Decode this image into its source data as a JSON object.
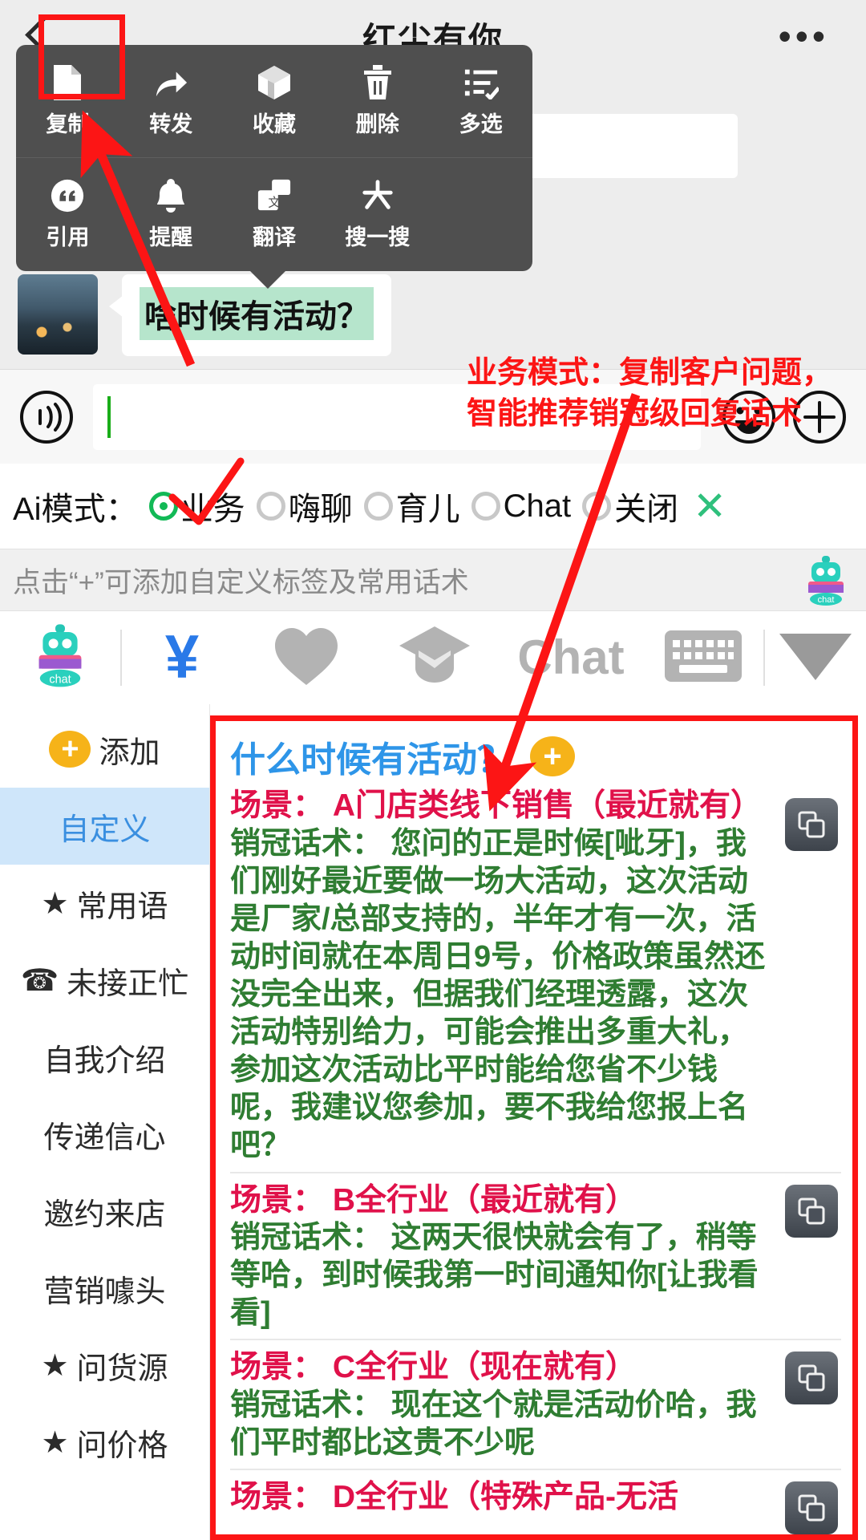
{
  "header": {
    "title": "红尘有你",
    "back_icon": "back-chevron-icon",
    "more_icon": "more-dots-icon"
  },
  "context_menu": {
    "row1": [
      {
        "label": "复制",
        "icon": "copy-document-icon",
        "highlighted": true
      },
      {
        "label": "转发",
        "icon": "forward-arrow-icon"
      },
      {
        "label": "收藏",
        "icon": "favorite-box-icon"
      },
      {
        "label": "删除",
        "icon": "trash-icon"
      },
      {
        "label": "多选",
        "icon": "multi-select-icon"
      }
    ],
    "row2": [
      {
        "label": "引用",
        "icon": "quote-icon"
      },
      {
        "label": "提醒",
        "icon": "bell-icon"
      },
      {
        "label": "翻译",
        "icon": "translate-icon"
      },
      {
        "label": "搜一搜",
        "icon": "search-sparkle-icon"
      }
    ]
  },
  "chat": {
    "avatar": "user-avatar",
    "message_text": "啥时候有活动？"
  },
  "input_bar": {
    "voice_icon": "voice-wave-icon",
    "input_value": "",
    "emoji_icon": "smiley-icon",
    "plus_icon": "plus-circle-icon"
  },
  "ai_mode": {
    "label": "Ai模式：",
    "options": [
      {
        "label": "业务",
        "selected": true
      },
      {
        "label": "嗨聊",
        "selected": false
      },
      {
        "label": "育儿",
        "selected": false
      },
      {
        "label": "Chat",
        "selected": false
      },
      {
        "label": "关闭",
        "selected": false
      }
    ],
    "close_icon": "close-x-icon",
    "accent_color": "#12b956"
  },
  "hint": {
    "text": "点击“+”可添加自定义标签及常用话术",
    "bot_icon": "robot-chat-icon"
  },
  "icon_toolbar": [
    {
      "name": "robot-chat-icon",
      "label": "chat"
    },
    {
      "name": "yuan-currency-icon",
      "label": "¥"
    },
    {
      "name": "heart-icon",
      "label": ""
    },
    {
      "name": "graduation-cap-icon",
      "label": ""
    },
    {
      "name": "chat-text-icon",
      "label": "Chat"
    },
    {
      "name": "keyboard-icon",
      "label": ""
    },
    {
      "name": "chevron-down-triangle-icon",
      "label": ""
    }
  ],
  "sidebar": {
    "items": [
      {
        "label": "添加",
        "icon": "plus-badge-icon",
        "active": false
      },
      {
        "label": "自定义",
        "icon": "",
        "active": true
      },
      {
        "label": "常用语",
        "icon": "star-icon",
        "active": false
      },
      {
        "label": "未接正忙",
        "icon": "telephone-icon",
        "active": false
      },
      {
        "label": "自我介绍",
        "icon": "",
        "active": false
      },
      {
        "label": "传递信心",
        "icon": "",
        "active": false
      },
      {
        "label": "邀约来店",
        "icon": "",
        "active": false
      },
      {
        "label": "营销噱头",
        "icon": "",
        "active": false
      },
      {
        "label": "问货源",
        "icon": "star-icon",
        "active": false
      },
      {
        "label": "问价格",
        "icon": "star-icon",
        "active": false
      }
    ]
  },
  "content": {
    "question_title": "什么时候有活动？",
    "add_icon": "plus-badge-icon",
    "scene_label": "场景：",
    "script_label": "销冠话术：",
    "copy_icon": "copy-duplicate-icon",
    "scenes": [
      {
        "head": "场景： A门店类线下销售（最近就有）",
        "body": "销冠话术： 您问的正是时候[呲牙]，我们刚好最近要做一场大活动，这次活动是厂家/总部支持的，半年才有一次，活动时间就在本周日9号，价格政策虽然还没完全出来，但据我们经理透露，这次活动特别给力，可能会推出多重大礼，参加这次活动比平时能给您省不少钱呢，我建议您参加，要不我给您报上名吧？"
      },
      {
        "head": "场景： B全行业（最近就有）",
        "body": "销冠话术： 这两天很快就会有了，稍等等哈，到时候我第一时间通知你[让我看看]"
      },
      {
        "head": "场景： C全行业（现在就有）",
        "body": "销冠话术： 现在这个就是活动价哈，我们平时都比这贵不少呢"
      },
      {
        "head": "场景： D全行业（特殊产品-无活",
        "body": ""
      }
    ]
  },
  "annotations": {
    "callout_text": "业务模式：复制客户问题，\n智能推荐销冠级回复话术",
    "color": "#fc1515"
  }
}
